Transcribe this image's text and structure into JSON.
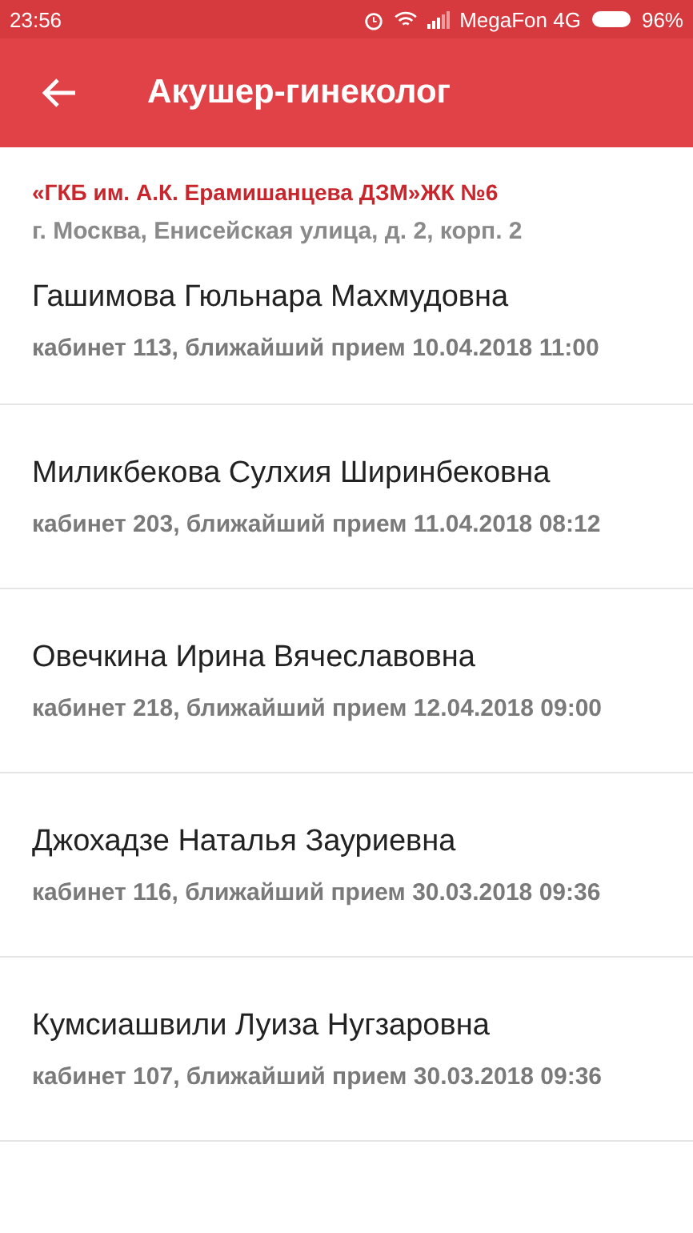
{
  "status_bar": {
    "time": "23:56",
    "carrier": "MegaFon 4G",
    "battery": "96%"
  },
  "app_bar": {
    "title": "Акушер-гинеколог"
  },
  "clinic": {
    "name": "«ГКБ им. А.К. Ерамишанцева ДЗМ»ЖК №6",
    "address": "г. Москва, Енисейская улица, д. 2, корп. 2"
  },
  "doctors": [
    {
      "name": "Гашимова Гюльнара Махмудовна",
      "details": "кабинет 113, ближайший прием 10.04.2018 11:00"
    },
    {
      "name": "Миликбекова Сулхия Ширинбековна",
      "details": "кабинет 203, ближайший прием 11.04.2018 08:12"
    },
    {
      "name": "Овечкина Ирина Вячеславовна",
      "details": "кабинет 218, ближайший прием 12.04.2018 09:00"
    },
    {
      "name": "Джохадзе Наталья Зауриевна",
      "details": "кабинет 116, ближайший прием 30.03.2018 09:36"
    },
    {
      "name": "Кумсиашвили Луиза Нугзаровна",
      "details": "кабинет 107, ближайший прием 30.03.2018 09:36"
    }
  ]
}
